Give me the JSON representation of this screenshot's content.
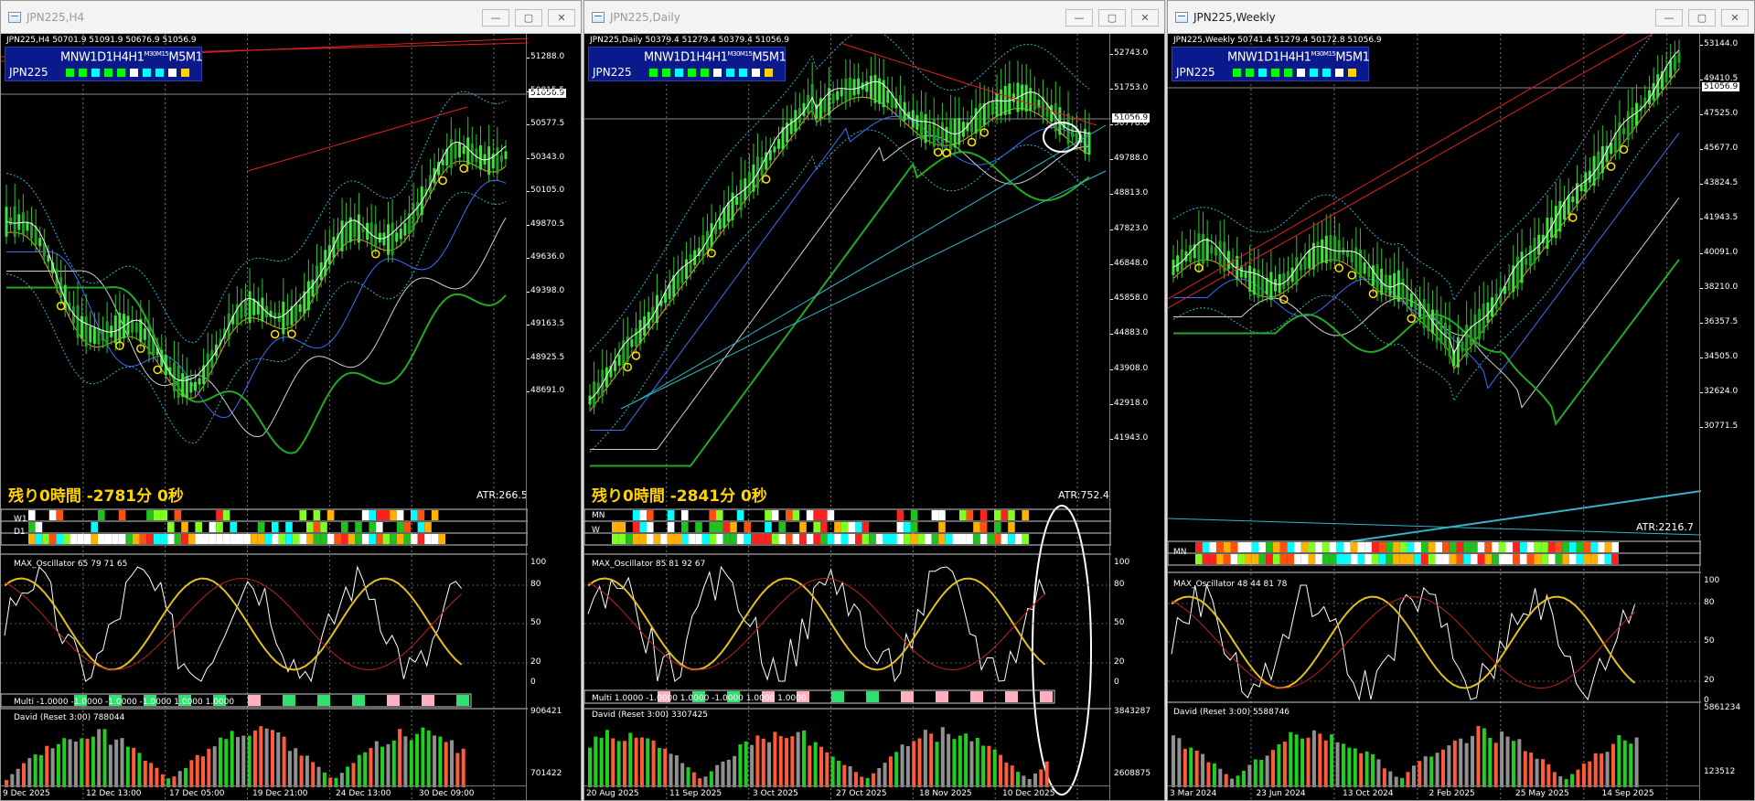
{
  "windows": [
    {
      "title": "JPN225,H4",
      "header": "JPN225,H4  50701.9 51091.9 50676.9 51056.9",
      "tf_label": "MNW1D1H4H1",
      "tf_sup": "M30M15",
      "tf_tail": "M5M1",
      "symbol": "JPN225",
      "tf_colors": [
        "#00ff00",
        "#00ff00",
        "#00ffff",
        "#00ff00",
        "#00ff00",
        "#ffffff",
        "#00ffff",
        "#00ffff",
        "#ffffff",
        "#ffd400"
      ],
      "remain": "残り0時間 -2781分 0秒",
      "atr": "ATR:266.5",
      "price_now": "51056.9",
      "ticks": [
        "51288.0",
        "51056.9",
        "50815.5",
        "50577.5",
        "50343.0",
        "50105.0",
        "49870.5",
        "49636.0",
        "49398.0",
        "49163.5",
        "48925.5",
        "48691.0"
      ],
      "sub_rows": [
        "W1",
        "D1",
        ""
      ],
      "osc_label": "MAX_Oscillator 65 79 71 65",
      "osc_ticks": [
        "100",
        "80",
        "50",
        "20",
        "0"
      ],
      "multi_label": "Multi -1.0000 -1.0000 -1.0000 -1.0000 1.0000 1.0000",
      "david_label": "David (Reset 3:00) 788044",
      "david_ticks": [
        "906421",
        "701422"
      ],
      "dates": [
        "9 Dec 2025",
        "12 Dec 13:00",
        "17 Dec 05:00",
        "19 Dec 21:00",
        "24 Dec 13:00",
        "30 Dec 09:00"
      ]
    },
    {
      "title": "JPN225,Daily",
      "header": "JPN225,Daily  50379.4 51279.4 50379.4 51056.9",
      "tf_label": "MNW1D1H4H1",
      "tf_sup": "M30M15",
      "tf_tail": "M5M1",
      "symbol": "JPN225",
      "tf_colors": [
        "#00ff00",
        "#00ff00",
        "#00ffff",
        "#00ff00",
        "#00ff00",
        "#ffffff",
        "#00ffff",
        "#00ffff",
        "#ffffff",
        "#ffd400"
      ],
      "remain": "残り0時間 -2841分 0秒",
      "atr": "ATR:752.4",
      "price_now": "51056.9",
      "ticks": [
        "52743.0",
        "51753.0",
        "51056.9",
        "50778.0",
        "49788.0",
        "48813.0",
        "47823.0",
        "46848.0",
        "45858.0",
        "44883.0",
        "43908.0",
        "42918.0",
        "41943.0"
      ],
      "sub_rows": [
        "MN",
        "W",
        ""
      ],
      "osc_label": "MAX_Oscillator 85 81 92 67",
      "osc_ticks": [
        "100",
        "80",
        "50",
        "20",
        "0"
      ],
      "multi_label": "Multi 1.0000 -1.0000 1.0000 -1.0000 1.0000 1.0000",
      "david_label": "David (Reset 3:00) 3307425",
      "david_ticks": [
        "3843287",
        "2608875"
      ],
      "dates": [
        "20 Aug 2025",
        "11 Sep 2025",
        "3 Oct 2025",
        "27 Oct 2025",
        "18 Nov 2025",
        "10 Dec 2025"
      ]
    },
    {
      "title": "JPN225,Weekly",
      "header": "JPN225,Weekly  50741.4 51279.4 50172.8 51056.9",
      "tf_label": "MNW1D1H4H1",
      "tf_sup": "M30M15",
      "tf_tail": "M5M1",
      "symbol": "JPN225",
      "tf_colors": [
        "#00ff00",
        "#00ff00",
        "#00ffff",
        "#00ff00",
        "#00ff00",
        "#ffffff",
        "#00ffff",
        "#00ffff",
        "#ffffff",
        "#ffd400"
      ],
      "remain": "",
      "atr": "ATR:2216.7",
      "price_now": "51056.9",
      "ticks": [
        "53144.0",
        "51056.9",
        "49410.5",
        "47525.0",
        "45677.0",
        "43824.5",
        "41943.5",
        "40091.0",
        "38210.0",
        "36357.5",
        "34505.0",
        "32624.0",
        "30771.5"
      ],
      "sub_rows": [
        "MN",
        "",
        ""
      ],
      "osc_label": "MAX_Oscillator 48 44 81 78",
      "osc_ticks": [
        "100",
        "80",
        "50",
        "20",
        "0"
      ],
      "multi_label": "",
      "david_label": "David (Reset 3:00) 5588746",
      "david_ticks": [
        "5861234",
        "123512"
      ],
      "dates": [
        "3 Mar 2024",
        "23 Jun 2024",
        "13 Oct 2024",
        "2 Feb 2025",
        "25 May 2025",
        "14 Sep 2025"
      ]
    }
  ],
  "buttons": {
    "minimize": "—",
    "maximize": "▢",
    "close": "✕"
  }
}
